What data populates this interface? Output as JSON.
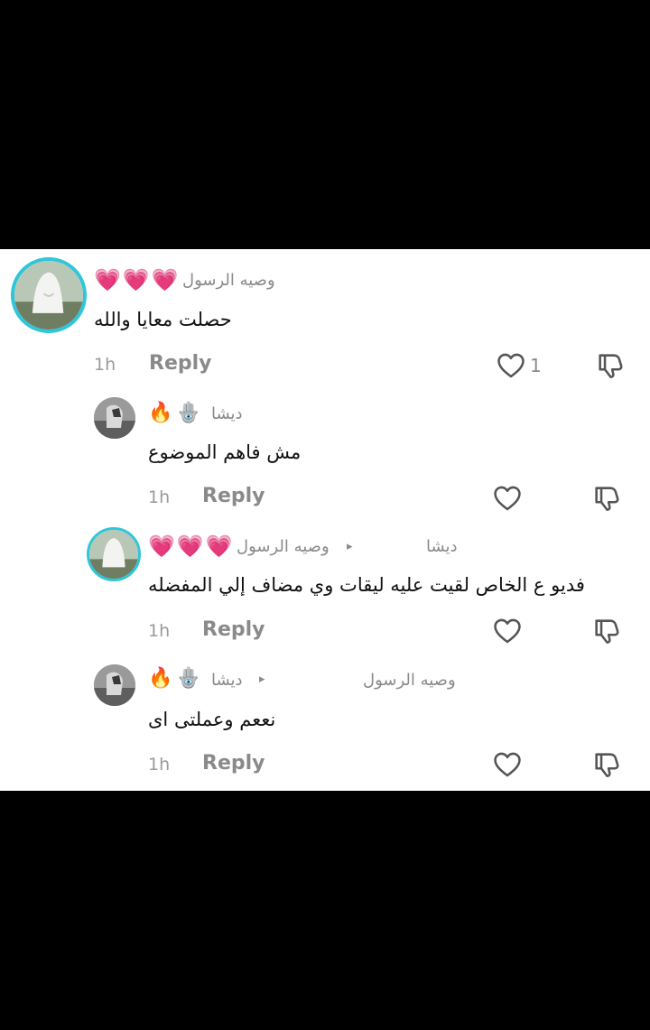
{
  "comments": [
    {
      "username": "وصيه الرسول",
      "emoji": [
        "💗",
        "💗",
        "💗"
      ],
      "text": "حصلت معايا والله",
      "time": "1h",
      "reply_label": "Reply",
      "likes": "1"
    },
    {
      "username": "ديشا",
      "emoji": [
        "🪬",
        "🔥"
      ],
      "text": "مش فاهم الموضوع",
      "time": "1h",
      "reply_label": "Reply"
    },
    {
      "username": "وصيه الرسول",
      "emoji": [
        "💗",
        "💗",
        "💗"
      ],
      "reply_to": "ديشا",
      "text": "فديو ع الخاص لقيت عليه ليقات وي مضاف إلي المفضله",
      "time": "1h",
      "reply_label": "Reply"
    },
    {
      "username": "ديشا",
      "emoji": [
        "🪬",
        "🔥"
      ],
      "reply_to": "وصيه الرسول",
      "text": "نععم وعملتى اى",
      "time": "1h",
      "reply_label": "Reply"
    }
  ],
  "colors": {
    "avatar_ring": "#2ec6d8",
    "secondary_text": "#8a8a8a",
    "primary_text": "#111111"
  },
  "icons": {
    "like": "heart-outline-icon",
    "dislike": "thumbs-down-outline-icon",
    "reply_arrow": "triangle-right-icon"
  }
}
